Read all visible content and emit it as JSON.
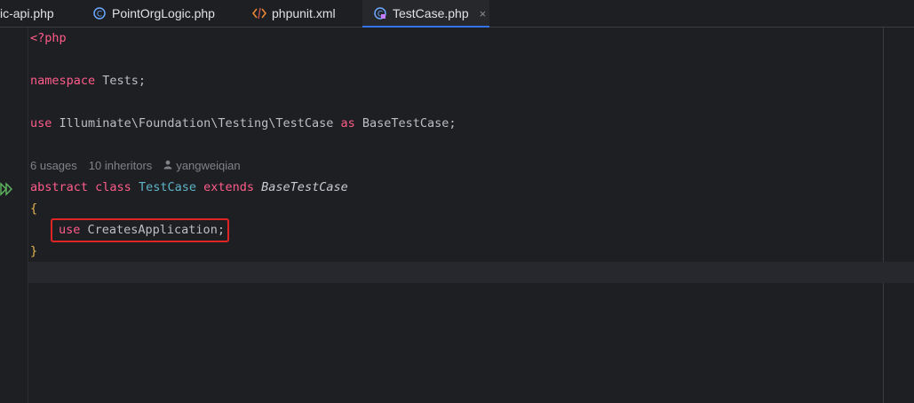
{
  "tabs": [
    {
      "label": "ic-api.php",
      "icon": "php-file-icon",
      "active": false
    },
    {
      "label": "PointOrgLogic.php",
      "icon": "php-class-icon",
      "active": false
    },
    {
      "label": "phpunit.xml",
      "icon": "xml-file-icon",
      "active": false
    },
    {
      "label": "TestCase.php",
      "icon": "php-class-icon",
      "active": true,
      "close": "×"
    }
  ],
  "code": {
    "line1": "<?php",
    "line3_kw": "namespace",
    "line3_rest": " Tests;",
    "line5_kw": "use",
    "line5_path": " Illuminate\\Foundation\\Testing\\TestCase ",
    "line5_as": "as",
    "line5_rest": " BaseTestCase;",
    "hint_usages": "6 usages",
    "hint_inheritors": "10 inheritors",
    "hint_author": "yangweiqian",
    "line7_abstract": "abstract",
    "line7_class": "class",
    "line7_name": "TestCase",
    "line7_extends": "extends",
    "line7_base": "BaseTestCase",
    "open_brace": "{",
    "trait_kw": "use",
    "trait_rest": " CreatesApplication;",
    "close_brace": "}"
  },
  "colors": {
    "accent": "#3574f0",
    "highlight": "#e02424",
    "keyword": "#ff5c8a",
    "class_name": "#5fb4c9"
  }
}
